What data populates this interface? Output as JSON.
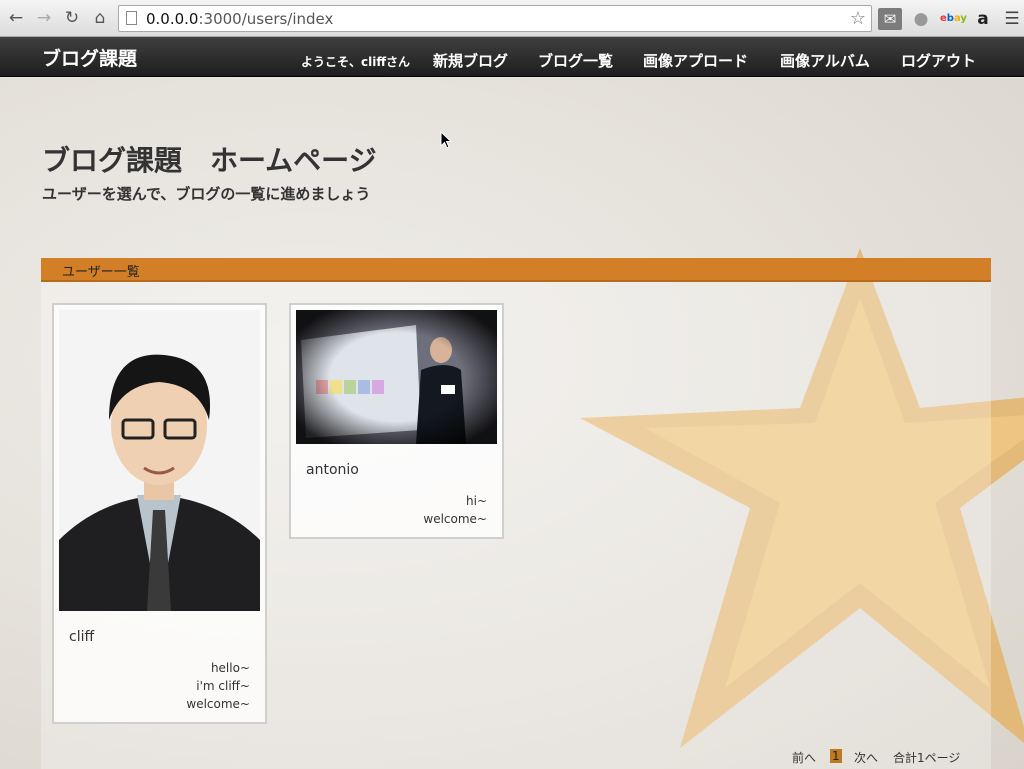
{
  "browser": {
    "url_host": "0.0.0.0",
    "url_rest": ":3000/users/index",
    "icons": [
      "back-icon",
      "forward-icon",
      "reload-icon",
      "home-icon",
      "page-icon",
      "star-icon",
      "gmail-icon",
      "globe-icon",
      "ebay-icon",
      "amazon-icon",
      "menu-icon"
    ]
  },
  "nav": {
    "brand": "ブログ課題",
    "welcome": "ようこそ、cliffさん",
    "items": [
      "新規ブログ",
      "ブログ一覧",
      "画像アプロード",
      "画像アルバム",
      "ログアウト"
    ]
  },
  "hero": {
    "title": "ブログ課題　ホームページ",
    "subtitle": "ユーザーを選んで、ブログの一覧に進めましょう"
  },
  "panel": {
    "header": "ユーザー一覧"
  },
  "users": [
    {
      "name": "cliff",
      "message": [
        "hello~",
        "i'm cliff~",
        "welcome~"
      ]
    },
    {
      "name": "antonio",
      "message": [
        "hi~",
        "welcome~"
      ]
    }
  ],
  "pagination": {
    "prev": "前へ",
    "current": "1",
    "next": "次へ",
    "total": "合計1ページ"
  },
  "colors": {
    "accent": "#d27f28",
    "navbar": "#2a2a2a"
  }
}
